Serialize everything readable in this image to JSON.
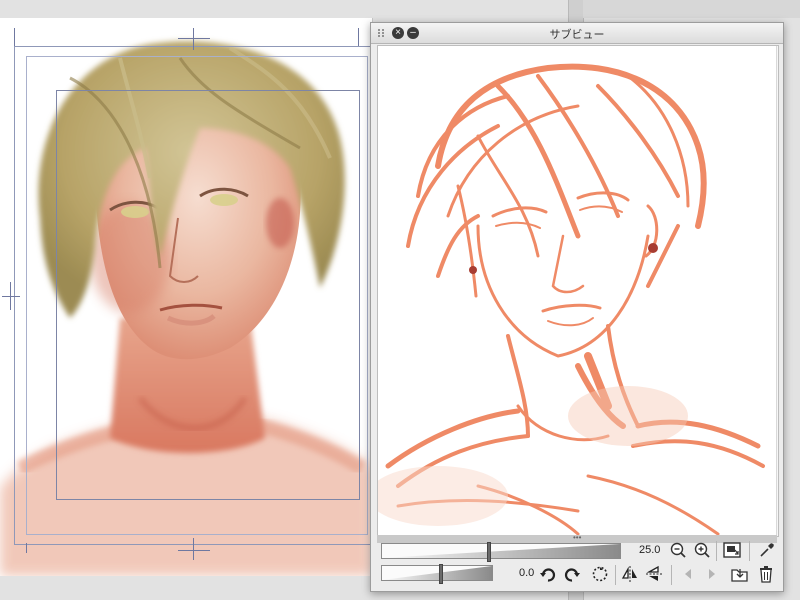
{
  "app": {
    "panel_title": "サブビュー"
  },
  "subview": {
    "zoom_value": "25.0",
    "rotate_value": "0.0",
    "zoom_level_fraction": 0.44,
    "rotate_level_fraction": 0.52,
    "icons": {
      "grip": "grip-icon",
      "close": "close-icon",
      "minimize": "minimize-icon",
      "zoom_out": "zoom-out-icon",
      "zoom_in": "zoom-in-icon",
      "fit": "fit-to-window-icon",
      "eyedropper": "eyedropper-icon",
      "rotate_left": "rotate-left-icon",
      "rotate_right": "rotate-right-icon",
      "reset_rotation": "reset-rotation-icon",
      "flip_horizontal": "flip-horizontal-icon",
      "flip_vertical": "flip-vertical-icon",
      "prev": "previous-image-icon",
      "next": "next-image-icon",
      "import": "import-image-icon",
      "delete": "delete-image-icon"
    }
  },
  "colors": {
    "sketch_stroke": "#ef8a66",
    "hair_color": "#b8a46a",
    "skin_color": "#e7b49a"
  }
}
